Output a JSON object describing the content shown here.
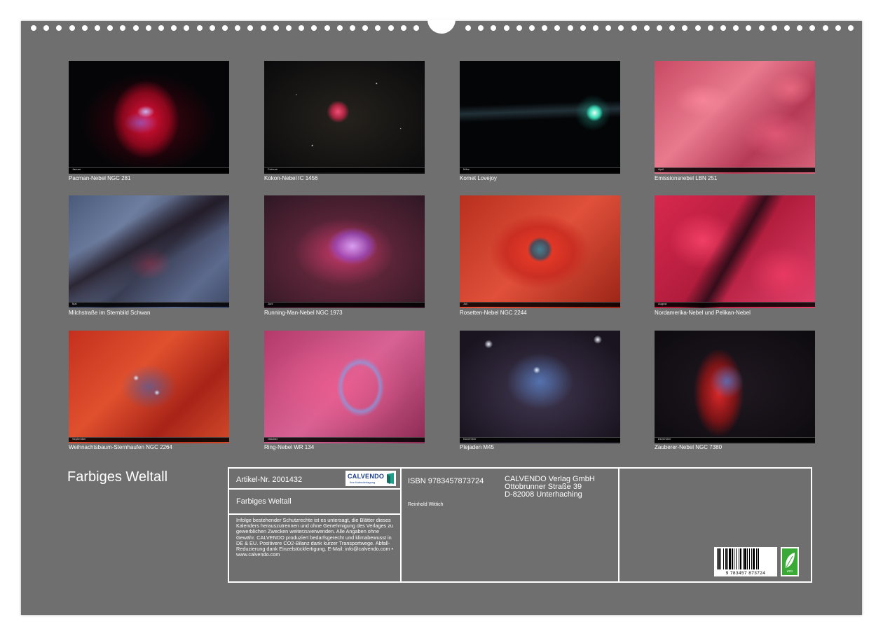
{
  "calendar": {
    "title": "Farbiges Weltall",
    "months": [
      {
        "caption": "Pacman-Nebel NGC 281",
        "bar_label": "Januar"
      },
      {
        "caption": "Kokon-Nebel IC 1456",
        "bar_label": "Februar"
      },
      {
        "caption": "Komet Lovejoy",
        "bar_label": "März"
      },
      {
        "caption": "Emissionsnebel  LBN 251",
        "bar_label": "April"
      },
      {
        "caption": "Milchstraße im Sternbild Schwan",
        "bar_label": "Mai"
      },
      {
        "caption": "Running-Man-Nebel NGC 1973",
        "bar_label": "Juni"
      },
      {
        "caption": "Rosetten-Nebel NGC 2244",
        "bar_label": "Juli"
      },
      {
        "caption": "Nordamerika-Nebel und Pelikan-Nebel",
        "bar_label": "August"
      },
      {
        "caption": "Weihnachtsbaum-Sternhaufen NGC 2264",
        "bar_label": "September"
      },
      {
        "caption": "Ring-Nebel WR 134",
        "bar_label": "Oktober"
      },
      {
        "caption": "Plejaden M45",
        "bar_label": "November"
      },
      {
        "caption": "Zauberer-Nebel NGC 7380",
        "bar_label": "Dezember"
      }
    ]
  },
  "info": {
    "article": "Artikel-Nr. 2001432",
    "logo_name": "CALVENDO",
    "logo_sub": "Ihre Kalendertagung",
    "title": "Farbiges Weltall",
    "legal": "Infolge bestehender Schutzrechte ist es untersagt, die Blätter dieses Kalenders herauszutrennen und ohne Genehmigung des Verlages zu gewerblichen Zwecken weiterzuverwenden. Alle Angaben ohne Gewähr. CALVENDO produziert bedarfsgerecht und klimabewusst in DE & EU. Positivere CO2-Bilanz dank kurzer Transportwege. Abfall-Reduzierung dank Einzelstückfertigung. E-Mail: info@calvendo.com • www.calvendo.com",
    "isbn": "ISBN 9783457873724",
    "author": "Reinhold Wittich",
    "publisher_name": "CALVENDO Verlag GmbH",
    "publisher_street": "Ottobrunner Straße 39",
    "publisher_city": "D-82008 Unterhaching",
    "barcode_digits": "9 783457 873724",
    "eco_label": "eco"
  },
  "colors": {
    "sheet": "#6f6f6f",
    "text": "#ffffff",
    "logo_blue": "#1a3d8f",
    "eco_green": "#3aa935"
  }
}
